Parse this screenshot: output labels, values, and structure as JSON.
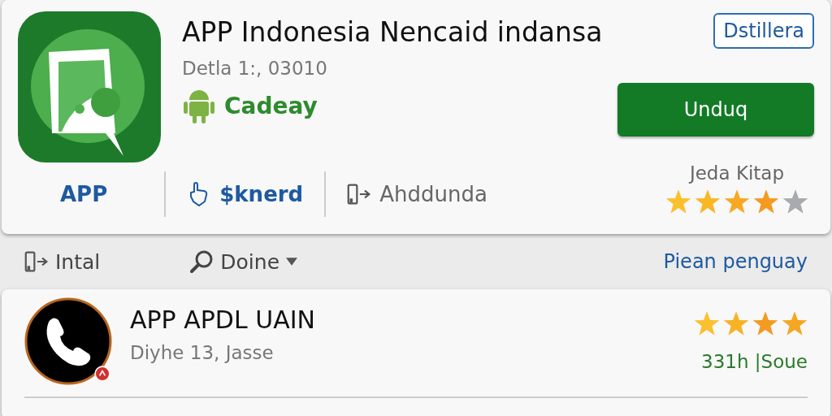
{
  "app": {
    "title": "APP Indonesia Nencaid indansa",
    "subtitle": "Detla 1:, 03010",
    "developer": "Cadeay",
    "secondary_button": "Dstillera",
    "primary_button": "Unduq",
    "rating_label": "Jeda Kitap",
    "stars": 4,
    "actions": [
      {
        "kind": "text",
        "label": "APP"
      },
      {
        "kind": "thumb",
        "label": "$knerd"
      },
      {
        "kind": "device",
        "label": "Ahddunda"
      }
    ]
  },
  "toolbar": {
    "items": [
      {
        "kind": "device",
        "label": "Intal"
      },
      {
        "kind": "search",
        "label": "Doine"
      }
    ],
    "link": "Piean penguay"
  },
  "list": [
    {
      "title": "APP APDL UAIN",
      "subtitle": "Diyhe 13, Jasse",
      "stars": 4,
      "meta": "331h |Soue"
    }
  ]
}
